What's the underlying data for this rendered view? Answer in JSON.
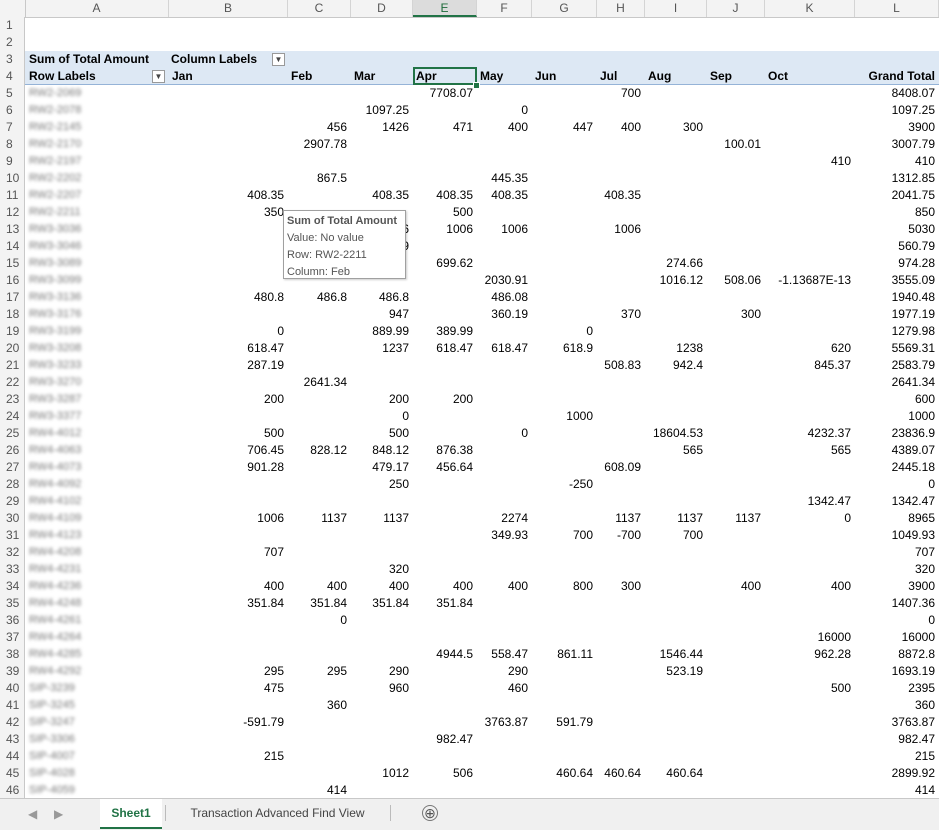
{
  "columns": [
    "A",
    "B",
    "C",
    "D",
    "E",
    "F",
    "G",
    "H",
    "I",
    "J",
    "K",
    "L"
  ],
  "selected_column": "E",
  "row_numbers": [
    "1",
    "2",
    "3",
    "4",
    "5",
    "6",
    "7",
    "8",
    "9",
    "10",
    "11",
    "12",
    "13",
    "14",
    "15",
    "16",
    "17",
    "18",
    "19",
    "20",
    "21",
    "22",
    "23",
    "24",
    "25",
    "26",
    "27",
    "28",
    "29",
    "30",
    "31",
    "32",
    "33",
    "34",
    "35",
    "36",
    "37",
    "38",
    "39",
    "40",
    "41",
    "42",
    "43",
    "44",
    "45",
    "46"
  ],
  "pivot": {
    "value_header": "Sum of Total Amount",
    "column_labels": "Column Labels",
    "row_labels": "Row Labels",
    "months": [
      "Jan",
      "Feb",
      "Mar",
      "Apr",
      "May",
      "Jun",
      "Jul",
      "Aug",
      "Sep",
      "Oct",
      "Grand Total"
    ],
    "rows": [
      {
        "label": "RW2-2069",
        "v": [
          "",
          "",
          "",
          "7708.07",
          "",
          "",
          "700",
          "",
          "",
          "",
          "8408.07"
        ]
      },
      {
        "label": "RW2-2078",
        "v": [
          "",
          "",
          "1097.25",
          "",
          "0",
          "",
          "",
          "",
          "",
          "",
          "1097.25"
        ]
      },
      {
        "label": "RW2-2145",
        "v": [
          "",
          "456",
          "1426",
          "471",
          "400",
          "447",
          "400",
          "300",
          "",
          "",
          "3900"
        ]
      },
      {
        "label": "RW2-2170",
        "v": [
          "",
          "2907.78",
          "",
          "",
          "",
          "",
          "",
          "",
          "100.01",
          "",
          "3007.79"
        ]
      },
      {
        "label": "RW2-2197",
        "v": [
          "",
          "",
          "",
          "",
          "",
          "",
          "",
          "",
          "",
          "410",
          "410"
        ]
      },
      {
        "label": "RW2-2202",
        "v": [
          "",
          "867.5",
          "",
          "",
          "445.35",
          "",
          "",
          "",
          "",
          "",
          "1312.85"
        ]
      },
      {
        "label": "RW2-2207",
        "v": [
          "408.35",
          "",
          "408.35",
          "408.35",
          "408.35",
          "",
          "408.35",
          "",
          "",
          "",
          "2041.75"
        ]
      },
      {
        "label": "RW2-2211",
        "v": [
          "350",
          "",
          "",
          "500",
          "",
          "",
          "",
          "",
          "",
          "",
          "850"
        ]
      },
      {
        "label": "RW3-3036",
        "v": [
          "",
          "",
          "6",
          "1006",
          "1006",
          "",
          "1006",
          "",
          "",
          "",
          "5030"
        ]
      },
      {
        "label": "RW3-3046",
        "v": [
          "",
          "",
          "9",
          "",
          "",
          "",
          "",
          "",
          "",
          "",
          "560.79"
        ]
      },
      {
        "label": "RW3-3089",
        "v": [
          "",
          "",
          "",
          "699.62",
          "",
          "",
          "",
          "274.66",
          "",
          "",
          "974.28"
        ]
      },
      {
        "label": "RW3-3099",
        "v": [
          "",
          "",
          "",
          "",
          "2030.91",
          "",
          "",
          "1016.12",
          "508.06",
          "-1.13687E-13",
          "3555.09"
        ]
      },
      {
        "label": "RW3-3136",
        "v": [
          "480.8",
          "486.8",
          "486.8",
          "",
          "486.08",
          "",
          "",
          "",
          "",
          "",
          "1940.48"
        ]
      },
      {
        "label": "RW3-3176",
        "v": [
          "",
          "",
          "947",
          "",
          "360.19",
          "",
          "370",
          "",
          "300",
          "",
          "1977.19"
        ]
      },
      {
        "label": "RW3-3199",
        "v": [
          "0",
          "",
          "889.99",
          "389.99",
          "",
          "0",
          "",
          "",
          "",
          "",
          "1279.98"
        ]
      },
      {
        "label": "RW3-3208",
        "v": [
          "618.47",
          "",
          "1237",
          "618.47",
          "618.47",
          "618.9",
          "",
          "1238",
          "",
          "620",
          "5569.31"
        ]
      },
      {
        "label": "RW3-3233",
        "v": [
          "287.19",
          "",
          "",
          "",
          "",
          "",
          "508.83",
          "942.4",
          "",
          "845.37",
          "2583.79"
        ]
      },
      {
        "label": "RW3-3270",
        "v": [
          "",
          "2641.34",
          "",
          "",
          "",
          "",
          "",
          "",
          "",
          "",
          "2641.34"
        ]
      },
      {
        "label": "RW3-3287",
        "v": [
          "200",
          "",
          "200",
          "200",
          "",
          "",
          "",
          "",
          "",
          "",
          "600"
        ]
      },
      {
        "label": "RW3-3377",
        "v": [
          "",
          "",
          "0",
          "",
          "",
          "1000",
          "",
          "",
          "",
          "",
          "1000"
        ]
      },
      {
        "label": "RW4-4012",
        "v": [
          "500",
          "",
          "500",
          "",
          "0",
          "",
          "",
          "18604.53",
          "",
          "4232.37",
          "23836.9"
        ]
      },
      {
        "label": "RW4-4063",
        "v": [
          "706.45",
          "828.12",
          "848.12",
          "876.38",
          "",
          "",
          "",
          "565",
          "",
          "565",
          "4389.07"
        ]
      },
      {
        "label": "RW4-4073",
        "v": [
          "901.28",
          "",
          "479.17",
          "456.64",
          "",
          "",
          "608.09",
          "",
          "",
          "",
          "2445.18"
        ]
      },
      {
        "label": "RW4-4092",
        "v": [
          "",
          "",
          "250",
          "",
          "",
          "-250",
          "",
          "",
          "",
          "",
          "0"
        ]
      },
      {
        "label": "RW4-4102",
        "v": [
          "",
          "",
          "",
          "",
          "",
          "",
          "",
          "",
          "",
          "1342.47",
          "1342.47"
        ]
      },
      {
        "label": "RW4-4109",
        "v": [
          "1006",
          "1137",
          "1137",
          "",
          "2274",
          "",
          "1137",
          "1137",
          "1137",
          "0",
          "8965"
        ]
      },
      {
        "label": "RW4-4123",
        "v": [
          "",
          "",
          "",
          "",
          "349.93",
          "700",
          "-700",
          "700",
          "",
          "",
          "1049.93"
        ]
      },
      {
        "label": "RW4-4208",
        "v": [
          "707",
          "",
          "",
          "",
          "",
          "",
          "",
          "",
          "",
          "",
          "707"
        ]
      },
      {
        "label": "RW4-4231",
        "v": [
          "",
          "",
          "320",
          "",
          "",
          "",
          "",
          "",
          "",
          "",
          "320"
        ]
      },
      {
        "label": "RW4-4236",
        "v": [
          "400",
          "400",
          "400",
          "400",
          "400",
          "800",
          "300",
          "",
          "400",
          "400",
          "3900"
        ]
      },
      {
        "label": "RW4-4248",
        "v": [
          "351.84",
          "351.84",
          "351.84",
          "351.84",
          "",
          "",
          "",
          "",
          "",
          "",
          "1407.36"
        ]
      },
      {
        "label": "RW4-4261",
        "v": [
          "",
          "0",
          "",
          "",
          "",
          "",
          "",
          "",
          "",
          "",
          "0"
        ]
      },
      {
        "label": "RW4-4264",
        "v": [
          "",
          "",
          "",
          "",
          "",
          "",
          "",
          "",
          "",
          "16000",
          "16000"
        ]
      },
      {
        "label": "RW4-4285",
        "v": [
          "",
          "",
          "",
          "4944.5",
          "558.47",
          "861.11",
          "",
          "1546.44",
          "",
          "962.28",
          "8872.8"
        ]
      },
      {
        "label": "RW4-4292",
        "v": [
          "295",
          "295",
          "290",
          "",
          "290",
          "",
          "",
          "523.19",
          "",
          "",
          "1693.19"
        ]
      },
      {
        "label": "SIP-3239",
        "v": [
          "475",
          "",
          "960",
          "",
          "460",
          "",
          "",
          "",
          "",
          "500",
          "2395"
        ]
      },
      {
        "label": "SIP-3245",
        "v": [
          "",
          "360",
          "",
          "",
          "",
          "",
          "",
          "",
          "",
          "",
          "360"
        ]
      },
      {
        "label": "SIP-3247",
        "v": [
          "-591.79",
          "",
          "",
          "",
          "3763.87",
          "591.79",
          "",
          "",
          "",
          "",
          "3763.87"
        ]
      },
      {
        "label": "SIP-3306",
        "v": [
          "",
          "",
          "",
          "982.47",
          "",
          "",
          "",
          "",
          "",
          "",
          "982.47"
        ]
      },
      {
        "label": "SIP-4007",
        "v": [
          "215",
          "",
          "",
          "",
          "",
          "",
          "",
          "",
          "",
          "",
          "215"
        ]
      },
      {
        "label": "SIP-4028",
        "v": [
          "",
          "",
          "1012",
          "506",
          "",
          "460.64",
          "460.64",
          "460.64",
          "",
          "",
          "2899.92"
        ]
      },
      {
        "label": "SIP-4059",
        "v": [
          "",
          "414",
          "",
          "",
          "",
          "",
          "",
          "",
          "",
          "",
          "414"
        ]
      }
    ]
  },
  "tooltip": {
    "title": "Sum of Total Amount",
    "value": "Value: No value",
    "row": "Row: RW2-2211",
    "column": "Column: Feb"
  },
  "tabs": {
    "active": "Sheet1",
    "other": "Transaction Advanced Find View",
    "add_symbol": "⊕"
  }
}
